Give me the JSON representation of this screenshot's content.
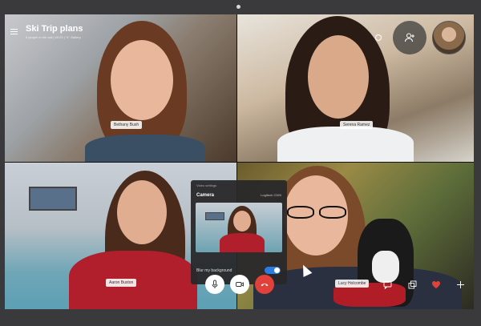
{
  "call": {
    "title": "Ski Trip plans",
    "subtitle": "5 people in the call | 00:23 | \"4\" Gallery"
  },
  "participants": [
    {
      "name": "Bethany Bush"
    },
    {
      "name": "Serena Ramez"
    },
    {
      "name": "Aaron Buxton"
    },
    {
      "name": "Lucy Holcombe"
    }
  ],
  "video_settings": {
    "header": "Video settings",
    "camera_label": "Camera",
    "device": "Logitech C920",
    "blur_label": "Blur my background",
    "blur_enabled": true
  },
  "colors": {
    "accent": "#2b7be0",
    "end_call": "#e0413a",
    "heart": "#e0413a"
  },
  "icons": {
    "menu": "menu-icon",
    "add_person": "add-person-icon",
    "mic": "microphone-icon",
    "video": "video-camera-icon",
    "end_call": "end-call-icon",
    "chat": "chat-icon",
    "popout": "popout-icon",
    "heart": "heart-icon",
    "plus": "plus-icon"
  }
}
